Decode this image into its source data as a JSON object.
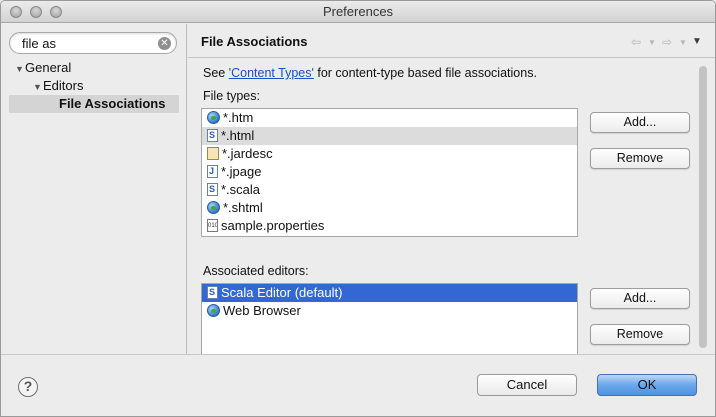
{
  "window": {
    "title": "Preferences"
  },
  "search": {
    "value": "file as"
  },
  "tree": [
    {
      "label": "General",
      "expanded": true
    },
    {
      "label": "Editors",
      "expanded": true
    },
    {
      "label": "File Associations",
      "selected": true
    }
  ],
  "page": {
    "title": "File Associations",
    "see_prefix": "See ",
    "see_link": "'Content Types'",
    "see_suffix": " for content-type based file associations.",
    "file_types_label": "File types:",
    "editors_label": "Associated editors:"
  },
  "file_types": [
    {
      "icon": "globe-icon",
      "label": "*.htm"
    },
    {
      "icon": "scala-file-icon",
      "label": "*.html",
      "selected": true
    },
    {
      "icon": "jar-file-icon",
      "label": "*.jardesc"
    },
    {
      "icon": "java-page-icon",
      "label": "*.jpage"
    },
    {
      "icon": "scala-file-icon",
      "label": "*.scala"
    },
    {
      "icon": "globe-icon",
      "label": "*.shtml"
    },
    {
      "icon": "properties-file-icon",
      "label": "sample.properties"
    }
  ],
  "editors": [
    {
      "icon": "scala-file-icon",
      "label": "Scala Editor (default)",
      "selected": true
    },
    {
      "icon": "globe-icon",
      "label": "Web Browser"
    }
  ],
  "buttons": {
    "add": "Add...",
    "remove": "Remove",
    "cancel": "Cancel",
    "ok": "OK"
  },
  "colors": {
    "selection_blue": "#3268d4",
    "selection_grey": "#dcdcdc",
    "link": "#1a4fc7"
  }
}
